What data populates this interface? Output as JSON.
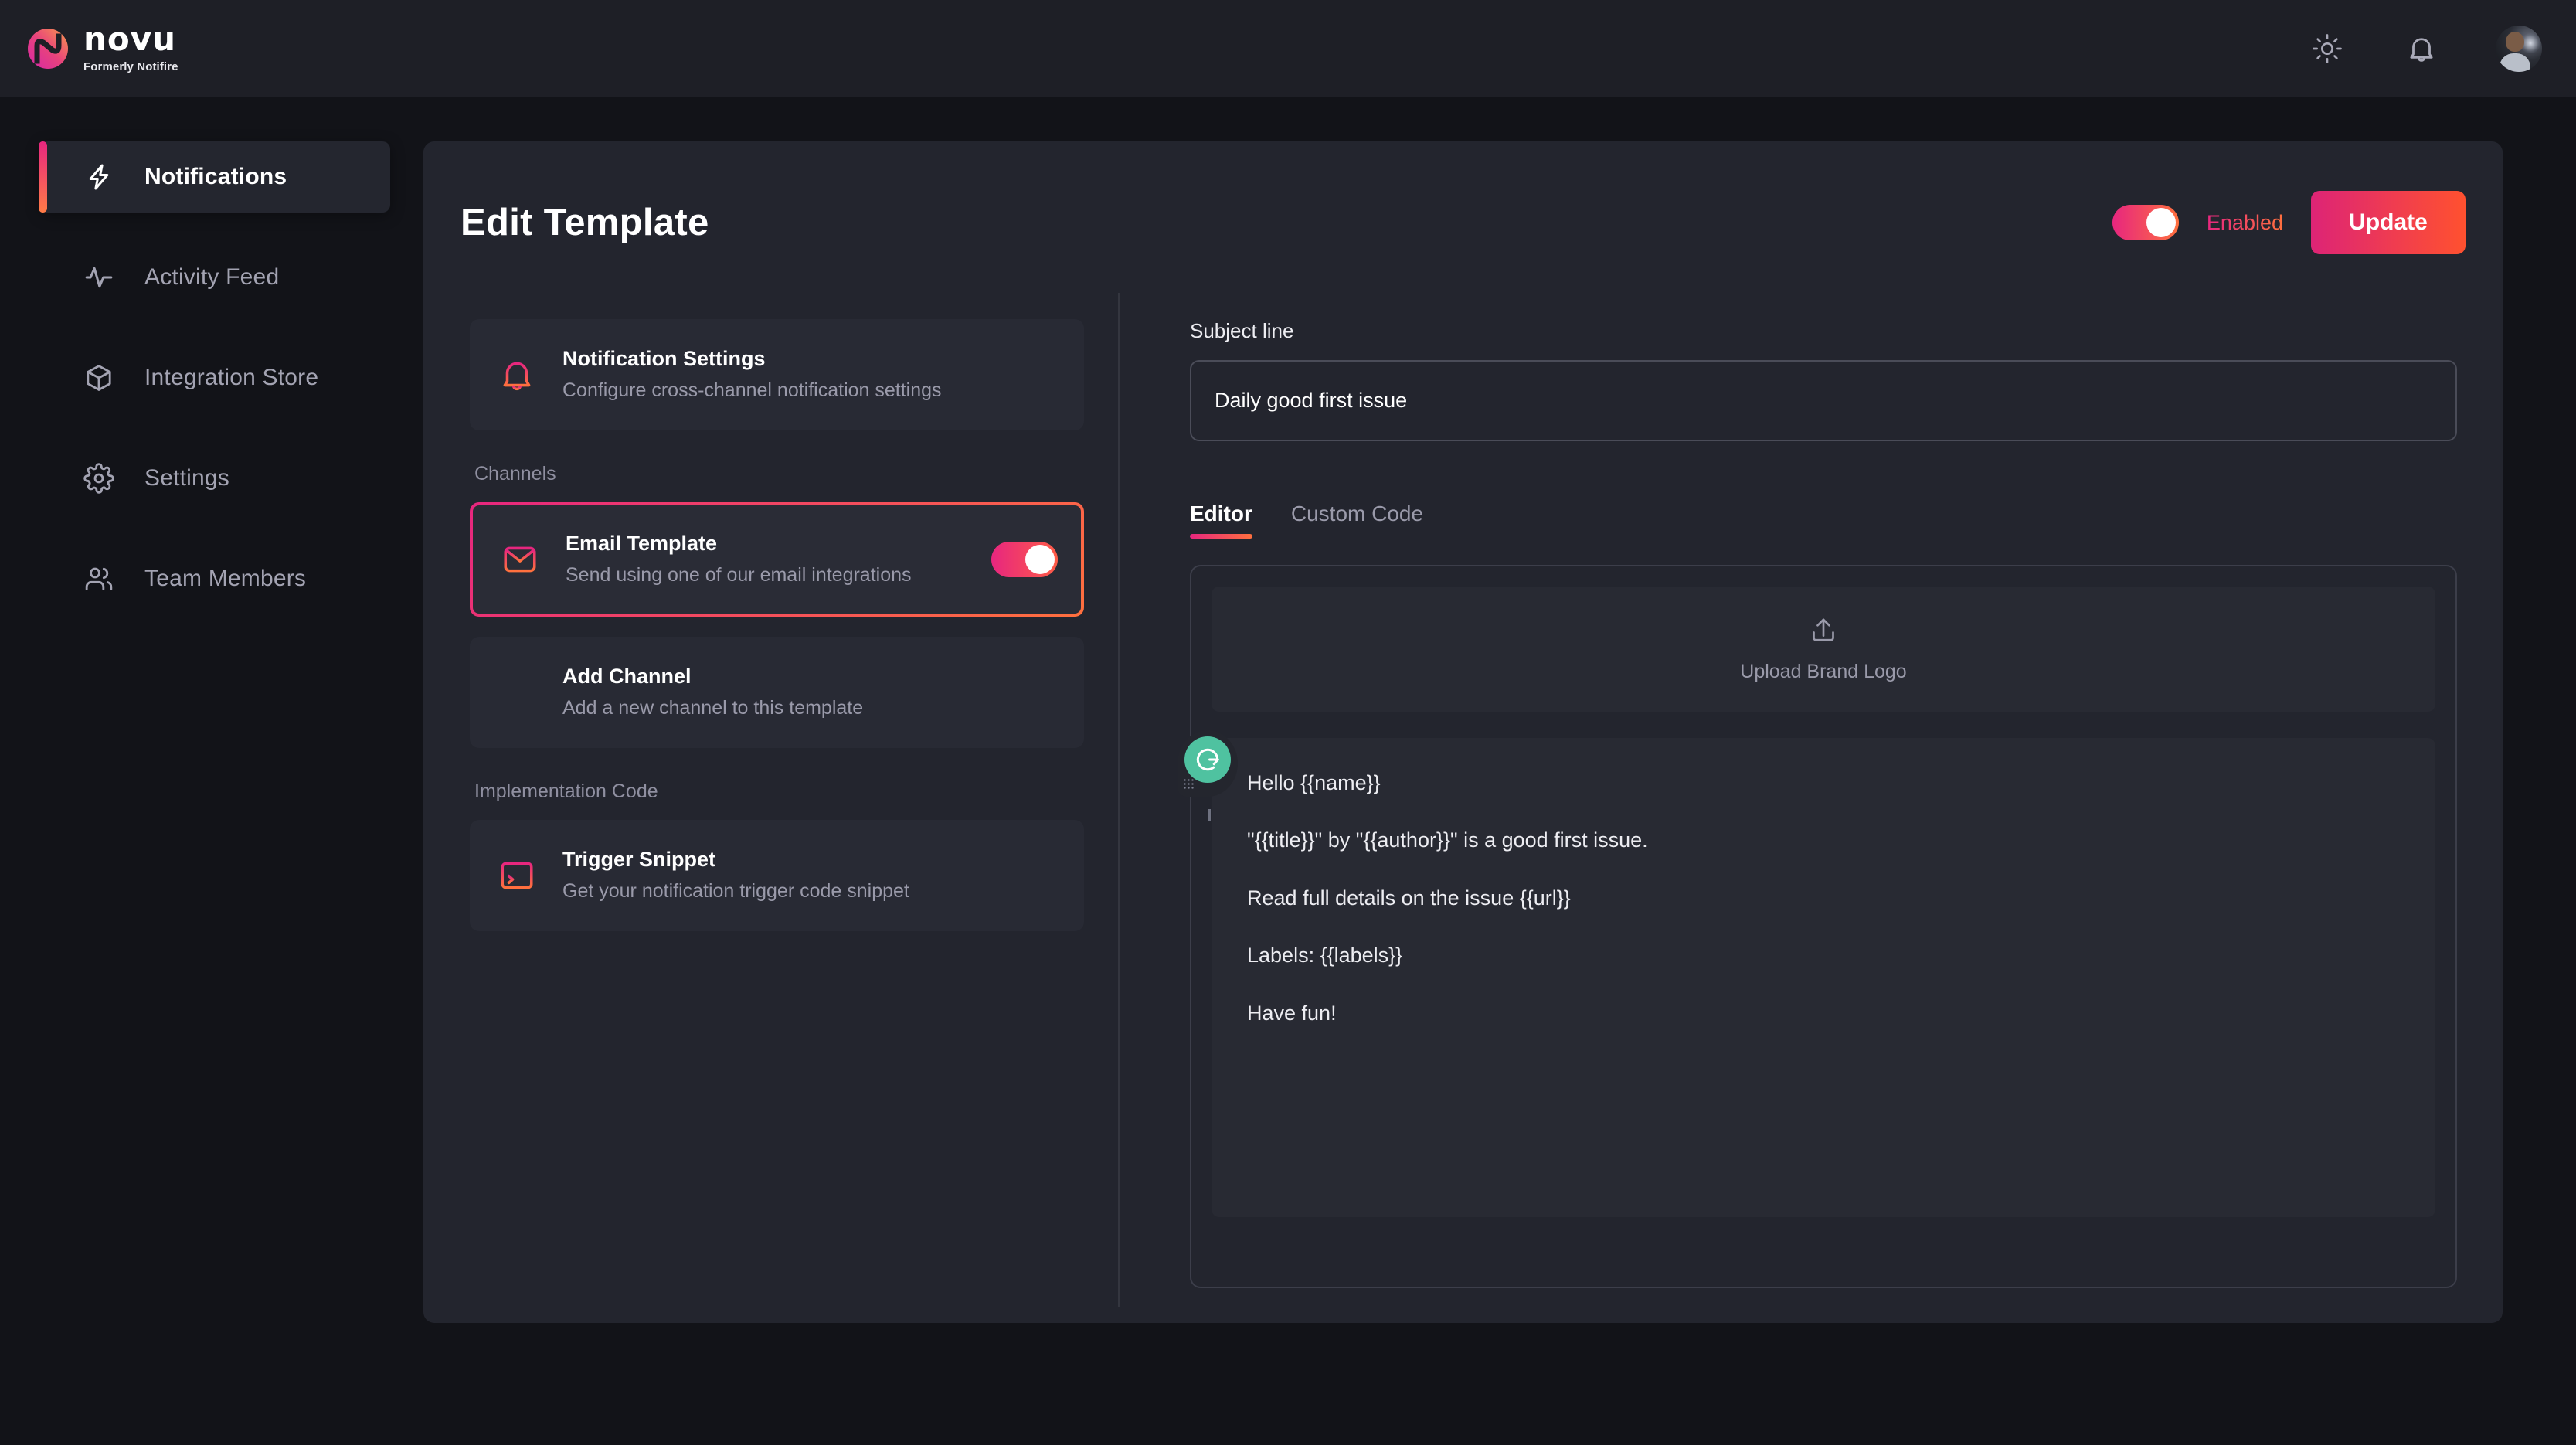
{
  "brand": {
    "name": "novu",
    "tagline": "Formerly Notifire",
    "logo_icon": "novu-logo-icon"
  },
  "topbar": {
    "theme_toggle_icon": "sun-icon",
    "notifications_icon": "bell-icon",
    "avatar_icon": "user-avatar"
  },
  "sidebar": {
    "items": [
      {
        "label": "Notifications",
        "icon": "lightning-bolt-icon",
        "active": true
      },
      {
        "label": "Activity Feed",
        "icon": "activity-pulse-icon",
        "active": false
      },
      {
        "label": "Integration Store",
        "icon": "box-icon",
        "active": false
      },
      {
        "label": "Settings",
        "icon": "gear-icon",
        "active": false
      },
      {
        "label": "Team Members",
        "icon": "users-icon",
        "active": false
      }
    ]
  },
  "header": {
    "title": "Edit Template",
    "toggle_label": "Enabled",
    "toggle_state": "on",
    "update_label": "Update"
  },
  "left_panel": {
    "notification_settings": {
      "title": "Notification Settings",
      "description": "Configure cross-channel notification settings",
      "icon": "bell-icon"
    },
    "channels_label": "Channels",
    "email_template": {
      "title": "Email Template",
      "description": "Send using one of our email integrations",
      "icon": "envelope-icon",
      "toggle_state": "on",
      "selected": true
    },
    "add_channel": {
      "title": "Add Channel",
      "description": "Add a new channel to this template",
      "icon": "plus-icon"
    },
    "implementation_code_label": "Implementation Code",
    "trigger_snippet": {
      "title": "Trigger Snippet",
      "description": "Get your notification trigger code snippet",
      "icon": "terminal-icon"
    }
  },
  "right_panel": {
    "subject_label": "Subject line",
    "subject_value": "Daily good first issue",
    "subject_placeholder": "Subject line",
    "tabs": [
      {
        "label": "Editor",
        "active": true
      },
      {
        "label": "Custom Code",
        "active": false
      }
    ],
    "upload": {
      "label": "Upload Brand Logo",
      "icon": "upload-icon"
    },
    "body_lines": [
      "Hello {{name}}",
      "\"{{title}}\" by \"{{author}}\" is a good first issue.",
      "Read full details on the issue {{url}}",
      "Labels: {{labels}}",
      "Have fun!"
    ],
    "grammarly_badge_icon": "grammarly-icon"
  },
  "colors": {
    "accent_start": "#E7267F",
    "accent_end": "#FF703E",
    "page_bg": "#121318",
    "panel_bg": "#23252E",
    "card_bg": "#282A34",
    "grammarly_green": "#4FC2A0"
  }
}
